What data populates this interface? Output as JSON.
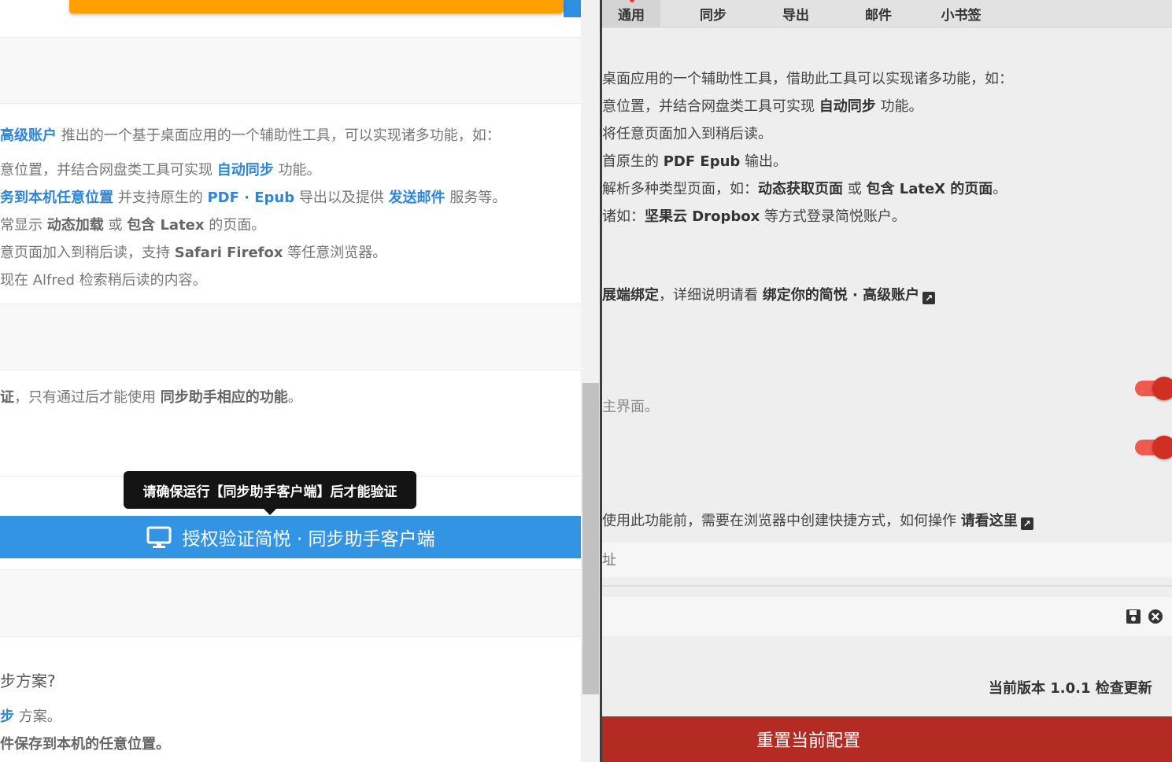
{
  "left": {
    "intro_highlight": "高级账户",
    "intro_rest": " 推出的一个基于桌面应用的一个辅助性工具，可以实现诸多功能，如：",
    "features": [
      {
        "a": "意位置，并结合网盘类工具可实现 ",
        "b": "自动同步",
        "c": " 功能。"
      },
      {
        "a": "务到本机任意位置",
        "b": " 并支持原生的 ",
        "c": "PDF · Epub",
        "d": " 导出以及提供 ",
        "e": "发送邮件",
        "f": " 服务等。"
      },
      {
        "a": "常显示 ",
        "b": "动态加载",
        "c": " 或 ",
        "d": "包含 Latex",
        "e": " 的页面。"
      },
      {
        "a": "意页面加入到稍后读，支持 ",
        "b": "Safari Firefox",
        "c": " 等任意浏览器。"
      },
      {
        "a": "现在 Alfred 检索稍后读的内容。"
      }
    ],
    "auth_note": {
      "a": "证",
      "b": "，只有通过后才能使用 ",
      "c": "同步助手相应的功能",
      "d": "。"
    },
    "tooltip": "请确保运行【同步助手客户端】后才能验证",
    "auth_button": "授权验证简悦 · 同步助手客户端",
    "faq_question": "步方案?",
    "faq_line1": {
      "a": "步",
      "b": " 方案。"
    },
    "faq_line2": "件保存到本机的任意位置。"
  },
  "right": {
    "tabs": [
      "通用",
      "同步",
      "导出",
      "邮件",
      "小书签"
    ],
    "desc_lines": [
      {
        "a": "桌面应用的一个辅助性工具，借助此工具可以实现诸多功能，如："
      },
      {
        "a": "意位置，并结合网盘类工具可实现 ",
        "b": "自动同步",
        "c": " 功能。"
      },
      {
        "a": "将任意页面加入到稍后读。"
      },
      {
        "a": "首原生的 ",
        "b": "PDF Epub",
        "c": " 输出。"
      },
      {
        "a": "解析多种类型页面，如：",
        "b": "动态获取页面",
        "c": " 或 ",
        "d": "包含 LateX 的页面",
        "e": "。"
      },
      {
        "a": "诸如：",
        "b": "坚果云 Dropbox",
        "c": " 等方式登录简悦账户。"
      }
    ],
    "bind_line": {
      "a": "展端绑定",
      "b": "，详细说明请看 ",
      "c": "绑定你的简悦 · 高级账户"
    },
    "toggle1_label": "主界面。",
    "shortcut_line": {
      "a": "使用此功能前，需要在浏览器中创建快捷方式，如何操作 ",
      "b": "请看这里"
    },
    "input_placeholder": "址",
    "version_line": "当前版本 1.0.1 检查更新",
    "reset_button": "重置当前配置",
    "accent_color": "#b32b23",
    "toggle_color": "#d22f23"
  }
}
